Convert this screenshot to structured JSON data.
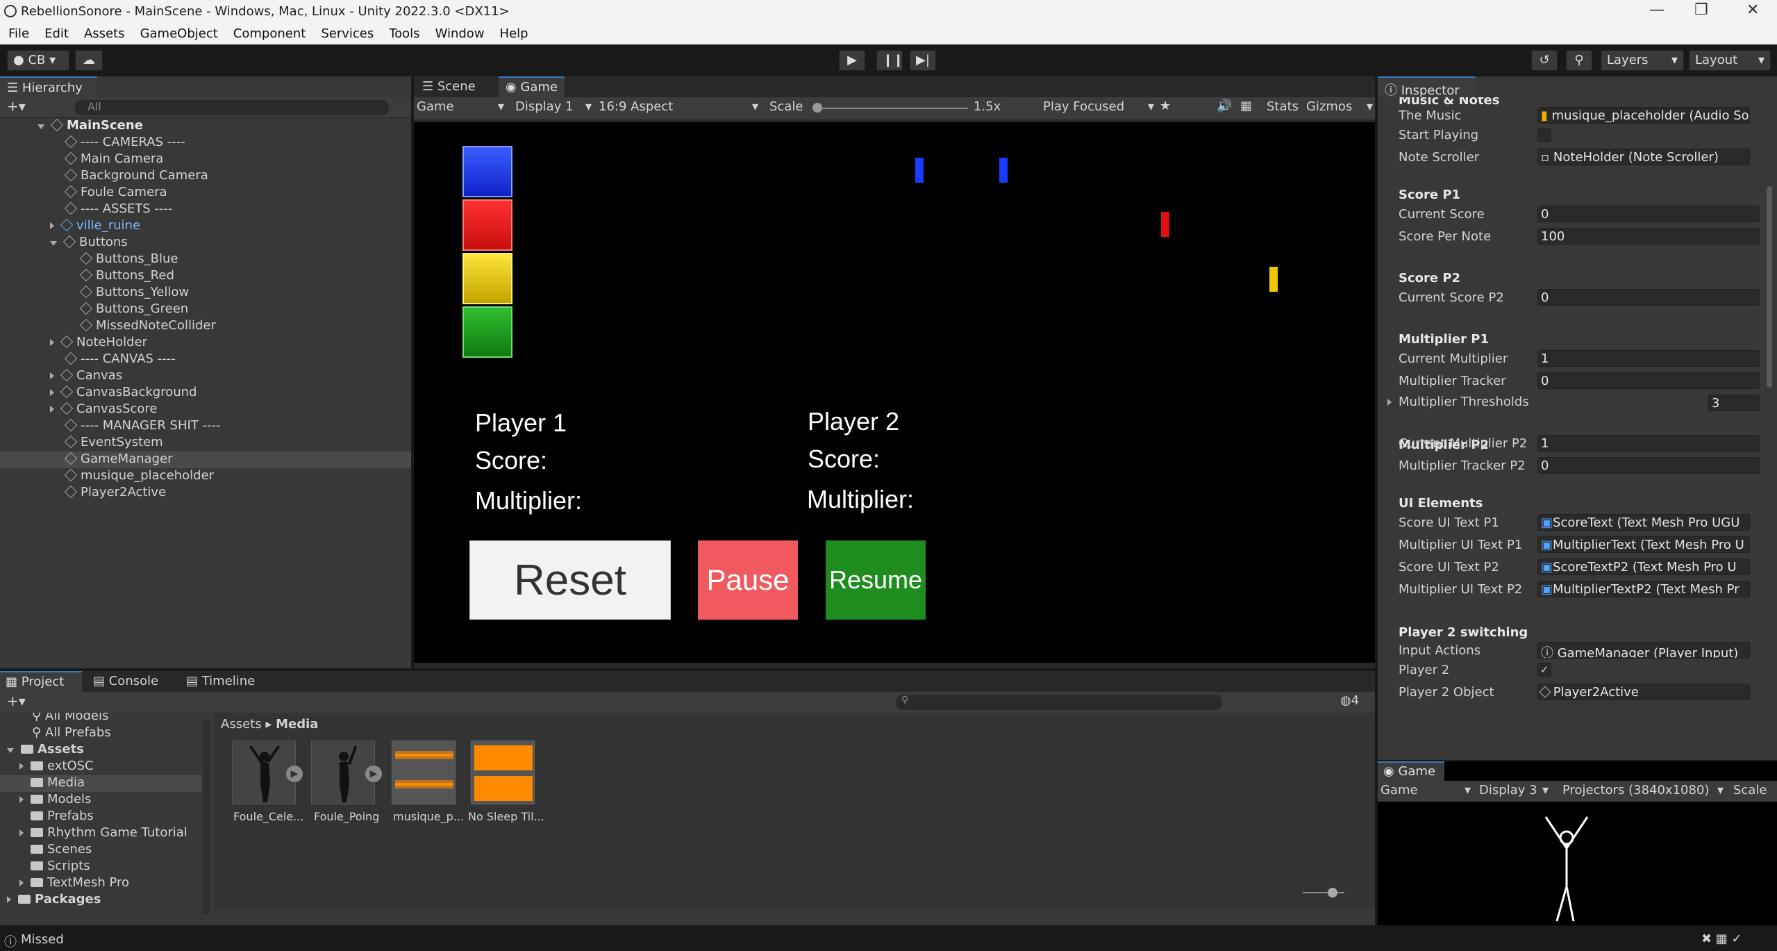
{
  "window": {
    "title": "RebellionSonore - MainScene - Windows, Mac, Linux - Unity 2022.3.0 <DX11>"
  },
  "menu": [
    "File",
    "Edit",
    "Assets",
    "GameObject",
    "Component",
    "Services",
    "Tools",
    "Window",
    "Help"
  ],
  "toolbar": {
    "account": "CB",
    "layers": "Layers",
    "layout": "Layout"
  },
  "hierarchy": {
    "tab": "Hierarchy",
    "search_placeholder": "All",
    "scene": "MainScene",
    "items": [
      {
        "label": "---- CAMERAS ----"
      },
      {
        "label": "Main Camera"
      },
      {
        "label": "Background Camera"
      },
      {
        "label": "Foule Camera"
      },
      {
        "label": "---- ASSETS ----"
      },
      {
        "label": "ville_ruine"
      },
      {
        "label": "Buttons"
      },
      {
        "label": "Buttons_Blue"
      },
      {
        "label": "Buttons_Red"
      },
      {
        "label": "Buttons_Yellow"
      },
      {
        "label": "Buttons_Green"
      },
      {
        "label": "MissedNoteCollider"
      },
      {
        "label": "NoteHolder"
      },
      {
        "label": "---- CANVAS ----"
      },
      {
        "label": "Canvas"
      },
      {
        "label": "CanvasBackground"
      },
      {
        "label": "CanvasScore"
      },
      {
        "label": "---- MANAGER SHIT ----"
      },
      {
        "label": "EventSystem"
      },
      {
        "label": "GameManager"
      },
      {
        "label": "musique_placeholder"
      },
      {
        "label": "Player2Active"
      }
    ]
  },
  "scene_tabs": {
    "scene": "Scene",
    "game": "Game"
  },
  "game_toolbar": {
    "mode": "Game",
    "display": "Display 1",
    "aspect": "16:9 Aspect",
    "scale_label": "Scale",
    "scale_value": "1.5x",
    "play_focus": "Play Focused",
    "stats": "Stats",
    "gizmos": "Gizmos"
  },
  "game_view": {
    "p1_name": "Player 1",
    "p1_score": "Score:",
    "p1_mult": "Multiplier:",
    "p2_name": "Player 2",
    "p2_score": "Score:",
    "p2_mult": "Multiplier:",
    "reset": "Reset",
    "pause": "Pause",
    "resume": "Resume"
  },
  "inspector": {
    "tab": "Inspector",
    "section_music": "Music & Notes",
    "the_music_label": "The Music",
    "the_music_value": "musique_placeholder (Audio So",
    "start_playing_label": "Start Playing",
    "note_scroller_label": "Note Scroller",
    "note_scroller_value": "NoteHolder (Note Scroller)",
    "score_p1": "Score P1",
    "current_score_label": "Current Score",
    "current_score_value": "0",
    "score_per_note_label": "Score Per Note",
    "score_per_note_value": "100",
    "score_p2": "Score P2",
    "current_score_p2_label": "Current Score P2",
    "current_score_p2_value": "0",
    "mult_p1": "Multiplier P1",
    "current_mult_label": "Current Multiplier",
    "current_mult_value": "1",
    "mult_tracker_label": "Multiplier Tracker",
    "mult_tracker_value": "0",
    "mult_thresholds_label": "Multiplier Thresholds",
    "mult_thresholds_value": "3",
    "mult_p2": "Multiplier P2",
    "current_mult_p2_label": "Current Multiplier P2",
    "current_mult_p2_value": "1",
    "mult_tracker_p2_label": "Multiplier Tracker P2",
    "mult_tracker_p2_value": "0",
    "ui_elements": "UI Elements",
    "score_ui_p1_label": "Score UI Text P1",
    "score_ui_p1_value": "ScoreText (Text Mesh Pro UGU",
    "mult_ui_p1_label": "Multiplier UI Text P1",
    "mult_ui_p1_value": "MultiplierText (Text Mesh Pro U",
    "score_ui_p2_label": "Score UI Text P2",
    "score_ui_p2_value": "ScoreTextP2 (Text Mesh Pro U",
    "mult_ui_p2_label": "Multiplier UI Text P2",
    "mult_ui_p2_value": "MultiplierTextP2 (Text Mesh Pr",
    "p2_switching": "Player 2 switching",
    "input_actions_label": "Input Actions",
    "input_actions_value": "GameManager (Player Input)",
    "player2_label": "Player 2",
    "player2_obj_label": "Player 2 Object",
    "player2_obj_value": "Player2Active"
  },
  "game2": {
    "tab": "Game",
    "mode": "Game",
    "display": "Display 3",
    "resolution": "Projectors (3840x1080)",
    "scale": "Scale"
  },
  "project": {
    "tabs": [
      "Project",
      "Console",
      "Timeline"
    ],
    "favorites": [
      "All Models",
      "All Prefabs"
    ],
    "root": "Assets",
    "folders": [
      "extOSC",
      "Media",
      "Models",
      "Prefabs",
      "Rhythm Game Tutorial",
      "Scenes",
      "Scripts",
      "TextMesh Pro"
    ],
    "packages": "Packages",
    "breadcrumb_root": "Assets",
    "breadcrumb_leaf": "Media",
    "hidden_count": "4",
    "assets": [
      {
        "label": "Foule_Cele..."
      },
      {
        "label": "Foule_Poing"
      },
      {
        "label": "musique_p..."
      },
      {
        "label": "No Sleep Til..."
      }
    ]
  },
  "status": {
    "message": "Missed"
  },
  "colors": {
    "accent": "#3a79bb",
    "blue": "#1a3cff",
    "red": "#ff1a1a",
    "yellow": "#f5d90a",
    "green": "#1aa31a",
    "pause": "#f05a5f",
    "resume": "#1e8c1e"
  }
}
